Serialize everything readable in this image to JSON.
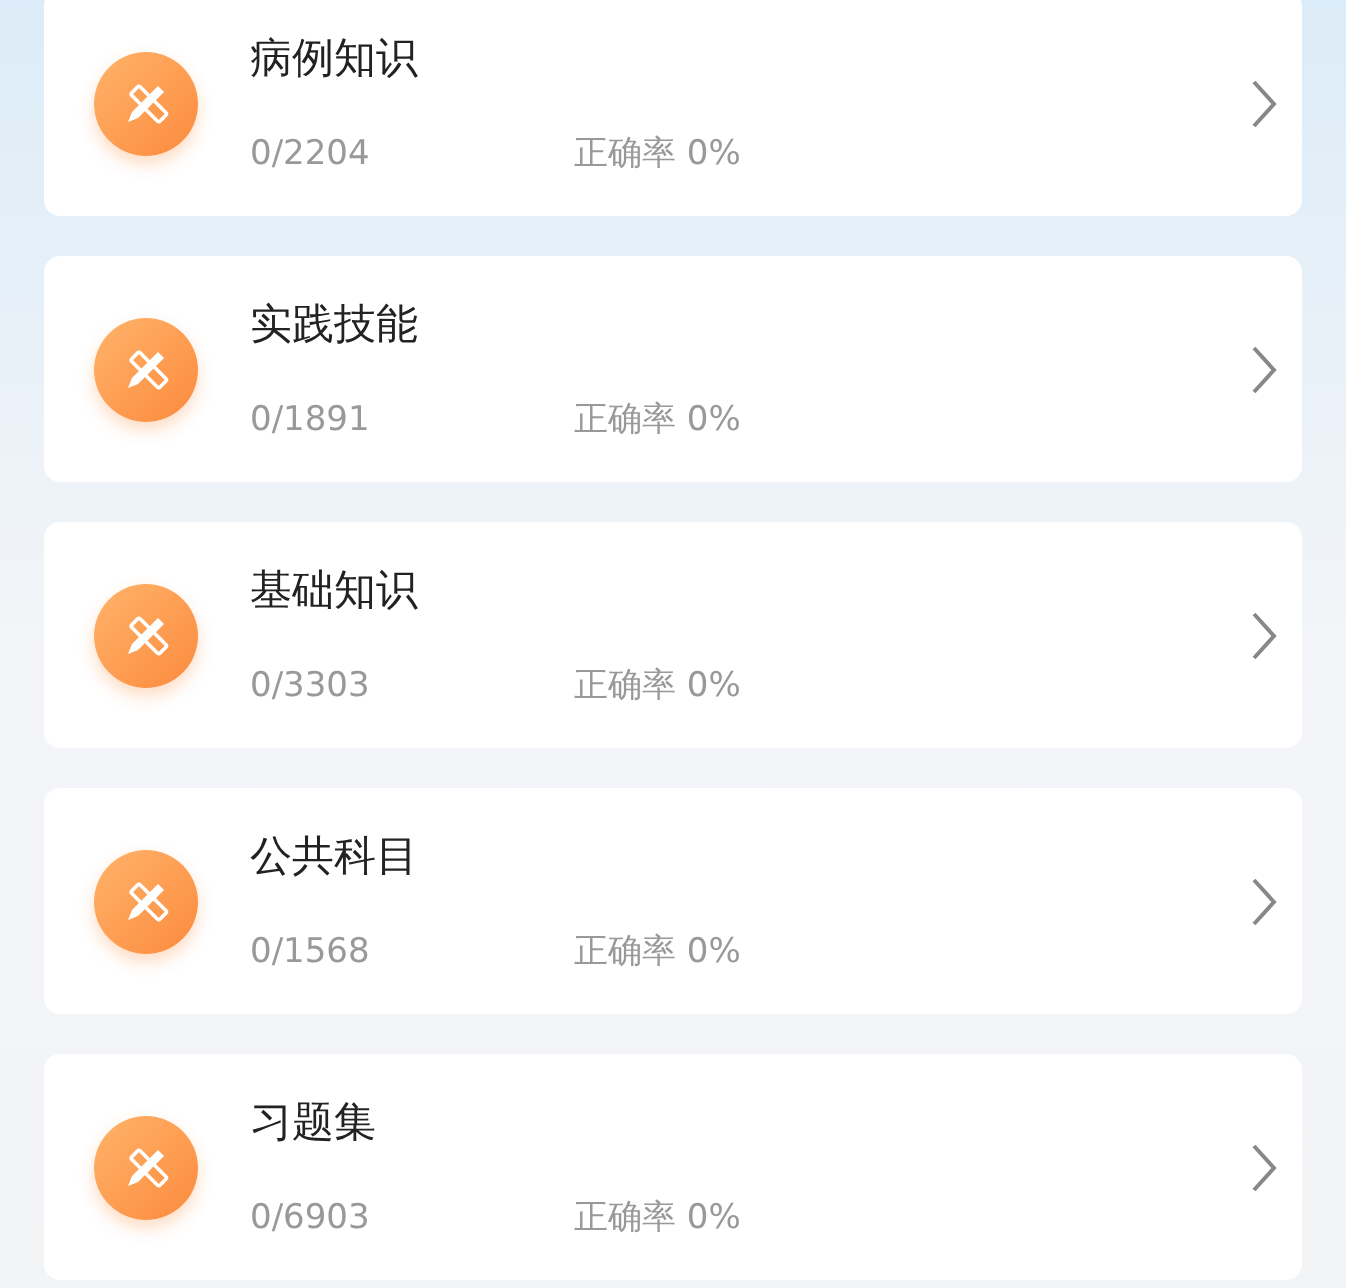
{
  "items": [
    {
      "title": "病例知识",
      "progress": "0/2204",
      "accuracy": "正确率 0%"
    },
    {
      "title": "实践技能",
      "progress": "0/1891",
      "accuracy": "正确率 0%"
    },
    {
      "title": "基础知识",
      "progress": "0/3303",
      "accuracy": "正确率 0%"
    },
    {
      "title": "公共科目",
      "progress": "0/1568",
      "accuracy": "正确率 0%"
    },
    {
      "title": "习题集",
      "progress": "0/6903",
      "accuracy": "正确率 0%"
    }
  ]
}
